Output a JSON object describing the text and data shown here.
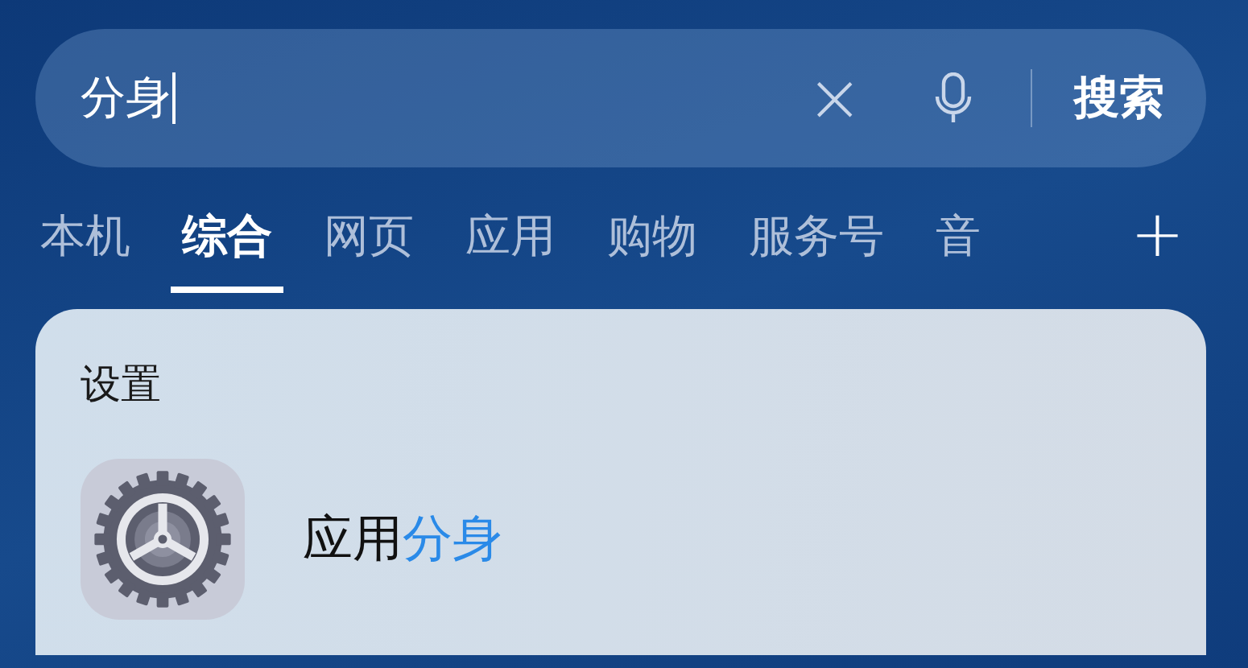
{
  "search": {
    "value": "分身",
    "clear": "×",
    "action": "搜索"
  },
  "tabs": [
    {
      "label": "本机",
      "selected": false
    },
    {
      "label": "综合",
      "selected": true
    },
    {
      "label": "网页",
      "selected": false
    },
    {
      "label": "应用",
      "selected": false
    },
    {
      "label": "购物",
      "selected": false
    },
    {
      "label": "服务号",
      "selected": false
    },
    {
      "label": "音",
      "selected": false
    }
  ],
  "add_tab": "+",
  "section": {
    "title": "设置",
    "results": [
      {
        "title": [
          {
            "text": "应用",
            "match": false
          },
          {
            "text": "分身",
            "match": true
          }
        ]
      }
    ]
  }
}
